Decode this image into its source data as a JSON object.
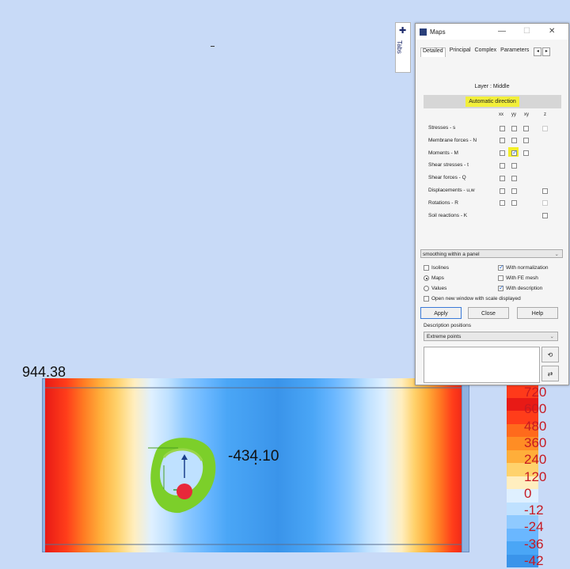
{
  "view": {
    "max_value": "944.38",
    "min_value": "-434.10"
  },
  "legend": {
    "ticks": [
      "720",
      "600",
      "480",
      "360",
      "240",
      "120",
      "0",
      "-12",
      "-24",
      "-36",
      "-42"
    ],
    "colors": [
      "#ff3a1a",
      "#e81a16",
      "#ff3d1a",
      "#ff6a1c",
      "#ff8d24",
      "#ffae3a",
      "#ffd26c",
      "#ffeebf",
      "#dff0ff",
      "#bfe1ff",
      "#8fcaff",
      "#6ab7ff",
      "#4aa6f6",
      "#3a94ea"
    ]
  },
  "side_tab": {
    "label": "Tabs",
    "pin_icon": "pin-icon"
  },
  "window": {
    "title": "Maps",
    "tabs": [
      "Detailed",
      "Principal",
      "Complex",
      "Parameters"
    ],
    "layer_label": "Layer : Middle",
    "automatic_direction": "Automatic direction",
    "columns": [
      "xx",
      "yy",
      "xy",
      "z"
    ],
    "rows": [
      "Stresses - s",
      "Membrane forces - N",
      "Moments - M",
      "Shear stresses - t",
      "Shear forces - Q",
      "Displacements - u,w",
      "Rotations - R",
      "Soil reactions - K"
    ],
    "smoothing": "smoothing within a panel",
    "options": {
      "isolines": "Isolines",
      "maps": "Maps",
      "values": "Values",
      "with_normalization": "With normalization",
      "with_fe_mesh": "With FE mesh",
      "with_description": "With description",
      "open_new_window": "Open new window with scale displayed"
    },
    "buttons": {
      "apply": "Apply",
      "close": "Close",
      "help": "Help"
    },
    "description_positions_label": "Description positions",
    "description_positions_value": "Extreme points"
  }
}
